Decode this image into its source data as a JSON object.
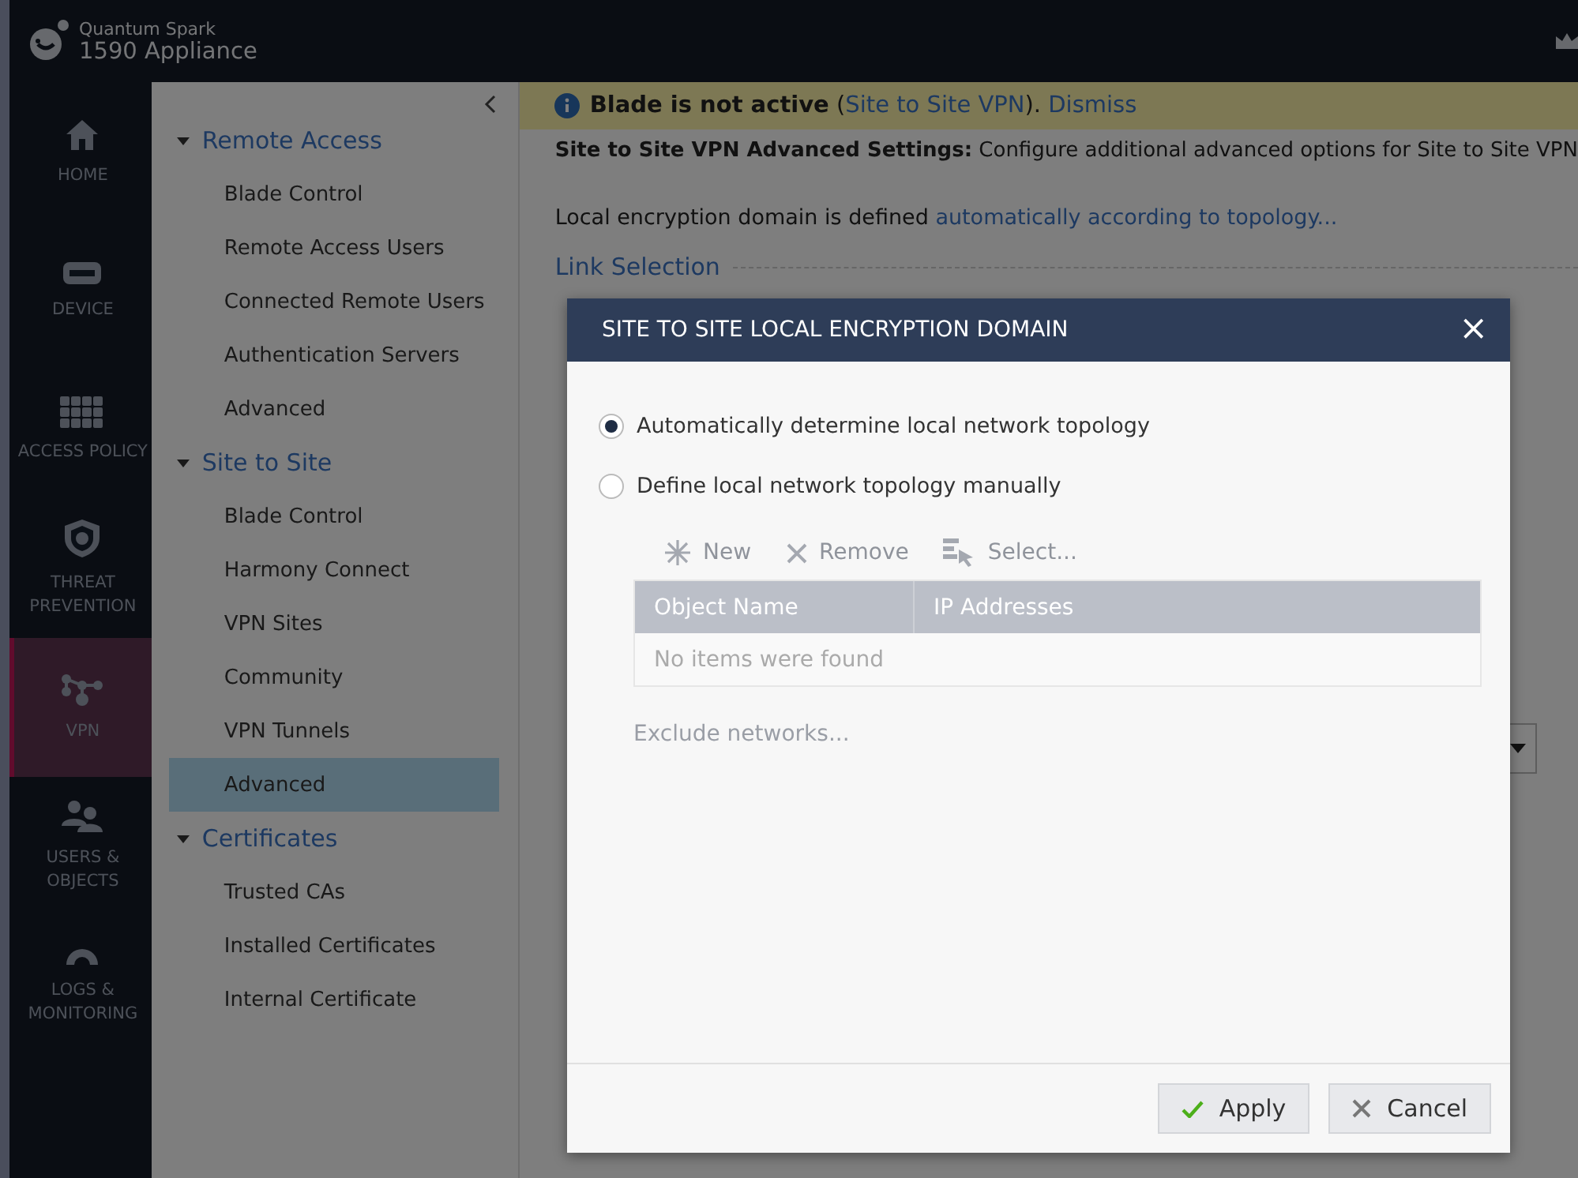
{
  "header": {
    "product": "Quantum Spark",
    "model": "1590 Appliance"
  },
  "nav": [
    {
      "label": "HOME",
      "kind": "home",
      "selected": false
    },
    {
      "label": "DEVICE",
      "kind": "device",
      "selected": false
    },
    {
      "label": "ACCESS POLICY",
      "kind": "grid",
      "selected": false
    },
    {
      "label": "THREAT PREVENTION",
      "kind": "shield",
      "selected": false
    },
    {
      "label": "VPN",
      "kind": "vpn",
      "selected": true
    },
    {
      "label": "USERS & OBJECTS",
      "kind": "users",
      "selected": false
    },
    {
      "label": "LOGS & MONITORING",
      "kind": "gauge",
      "selected": false
    }
  ],
  "tree": [
    {
      "label": "Remote Access",
      "expanded": true,
      "children": [
        {
          "label": "Blade Control",
          "selected": false
        },
        {
          "label": "Remote Access Users",
          "selected": false
        },
        {
          "label": "Connected Remote Users",
          "selected": false
        },
        {
          "label": "Authentication Servers",
          "selected": false
        },
        {
          "label": "Advanced",
          "selected": false
        }
      ]
    },
    {
      "label": "Site to Site",
      "expanded": true,
      "children": [
        {
          "label": "Blade Control",
          "selected": false
        },
        {
          "label": "Harmony Connect",
          "selected": false
        },
        {
          "label": "VPN Sites",
          "selected": false
        },
        {
          "label": "Community",
          "selected": false
        },
        {
          "label": "VPN Tunnels",
          "selected": false
        },
        {
          "label": "Advanced",
          "selected": true
        }
      ]
    },
    {
      "label": "Certificates",
      "expanded": true,
      "children": [
        {
          "label": "Trusted CAs",
          "selected": false
        },
        {
          "label": "Installed Certificates",
          "selected": false
        },
        {
          "label": "Internal Certificate",
          "selected": false
        }
      ]
    }
  ],
  "banner": [
    {
      "kind": "bold",
      "text": "Blade is not active"
    },
    {
      "kind": "plain",
      "text": " ("
    },
    {
      "kind": "link",
      "text": "Site to Site VPN"
    },
    {
      "kind": "plain",
      "text": "). "
    },
    {
      "kind": "link",
      "text": "Dismiss"
    }
  ],
  "description": "**Site to Site VPN Advanced Settings:** Configure additional advanced options for Site to Site VPN",
  "encryption_line": {
    "text": "Local encryption domain is defined ",
    "link": "automatically according to topology..."
  },
  "section_title": "Link Selection",
  "dialog": {
    "title": "SITE TO SITE LOCAL ENCRYPTION DOMAIN",
    "close": "×",
    "options": [
      {
        "label": "Automatically determine local network topology",
        "selected": true
      },
      {
        "label": "Define local network topology manually",
        "selected": false
      }
    ],
    "toolbar": [
      {
        "label": "New",
        "kind": "new",
        "disabled": true
      },
      {
        "label": "Remove",
        "kind": "remove",
        "disabled": true
      },
      {
        "label": "Select...",
        "kind": "select",
        "disabled": true
      }
    ],
    "table": {
      "columns": [
        "Object Name",
        "IP Addresses"
      ],
      "empty": "No items were found"
    },
    "exclude": {
      "label": "Exclude networks...",
      "disabled": true
    },
    "buttons": [
      {
        "label": "Apply",
        "kind": "apply"
      },
      {
        "label": "Cancel",
        "kind": "cancel"
      }
    ]
  }
}
